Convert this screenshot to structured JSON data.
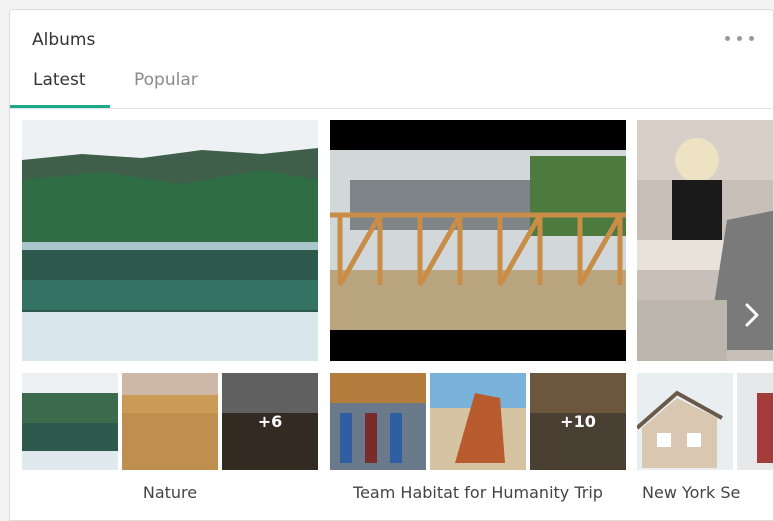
{
  "header": {
    "title": "Albums",
    "more_icon": "more-horizontal-icon"
  },
  "tabs": [
    {
      "label": "Latest",
      "active": true
    },
    {
      "label": "Popular",
      "active": false
    }
  ],
  "albums": [
    {
      "name": "Nature",
      "extra_count": "+6"
    },
    {
      "name": "Team Habitat for Humanity Trip",
      "extra_count": "+10"
    },
    {
      "name": "New York Se"
    }
  ],
  "carousel": {
    "next_icon": "chevron-right-icon"
  },
  "colors": {
    "accent": "#1ba98a",
    "text": "#333333",
    "muted": "#8a8a8a"
  }
}
